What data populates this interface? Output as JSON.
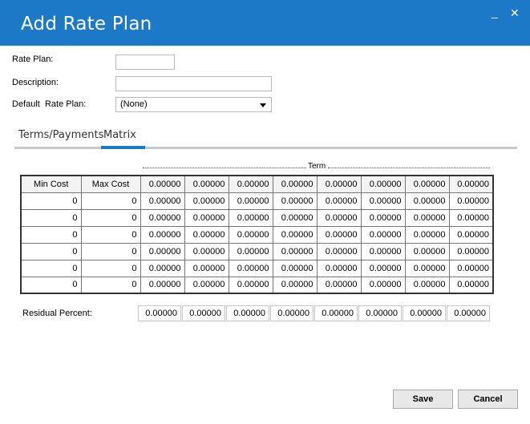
{
  "window": {
    "title": "Add Rate Plan",
    "minimize_glyph": "_",
    "close_glyph": "✕",
    "accent": "#1b79c7"
  },
  "form": {
    "rate_plan_label": "Rate Plan:",
    "rate_plan_value": "",
    "description_label": "Description:",
    "description_value": "",
    "default_label": "Default  Rate Plan:",
    "default_value": "(None)"
  },
  "tabs": [
    {
      "label": "Terms/Payments",
      "active": false
    },
    {
      "label": "Matrix",
      "active": true
    }
  ],
  "matrix": {
    "group_label": "Term",
    "headers": [
      "Min Cost",
      "Max Cost",
      "0.00000",
      "0.00000",
      "0.00000",
      "0.00000",
      "0.00000",
      "0.00000",
      "0.00000",
      "0.00000"
    ],
    "rows": [
      [
        "0",
        "0",
        "0.00000",
        "0.00000",
        "0.00000",
        "0.00000",
        "0.00000",
        "0.00000",
        "0.00000",
        "0.00000"
      ],
      [
        "0",
        "0",
        "0.00000",
        "0.00000",
        "0.00000",
        "0.00000",
        "0.00000",
        "0.00000",
        "0.00000",
        "0.00000"
      ],
      [
        "0",
        "0",
        "0.00000",
        "0.00000",
        "0.00000",
        "0.00000",
        "0.00000",
        "0.00000",
        "0.00000",
        "0.00000"
      ],
      [
        "0",
        "0",
        "0.00000",
        "0.00000",
        "0.00000",
        "0.00000",
        "0.00000",
        "0.00000",
        "0.00000",
        "0.00000"
      ],
      [
        "0",
        "0",
        "0.00000",
        "0.00000",
        "0.00000",
        "0.00000",
        "0.00000",
        "0.00000",
        "0.00000",
        "0.00000"
      ],
      [
        "0",
        "0",
        "0.00000",
        "0.00000",
        "0.00000",
        "0.00000",
        "0.00000",
        "0.00000",
        "0.00000",
        "0.00000"
      ]
    ]
  },
  "residual": {
    "label": "Residual Percent:",
    "values": [
      "0.00000",
      "0.00000",
      "0.00000",
      "0.00000",
      "0.00000",
      "0.00000",
      "0.00000",
      "0.00000"
    ]
  },
  "buttons": {
    "save": "Save",
    "cancel": "Cancel"
  }
}
